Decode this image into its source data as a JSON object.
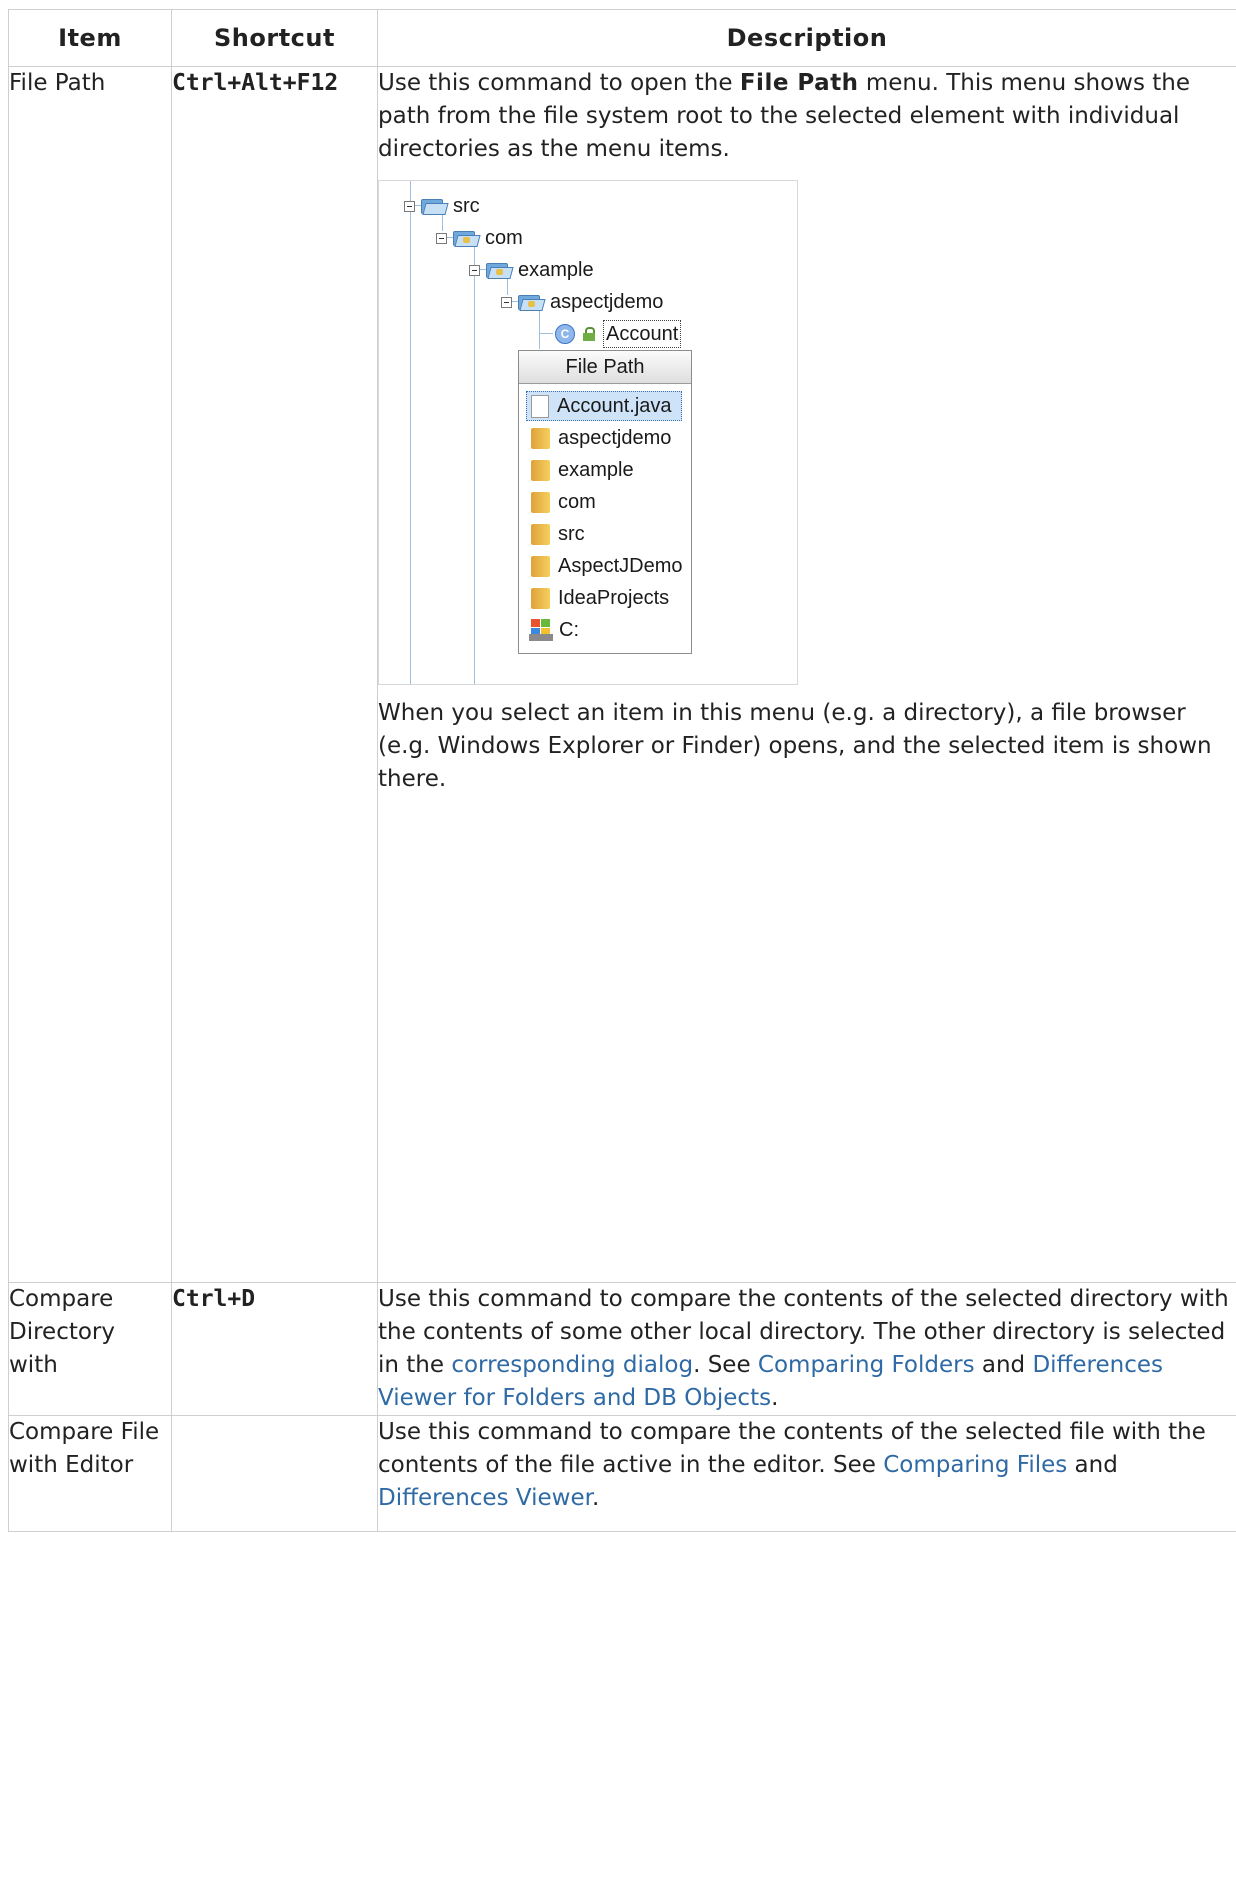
{
  "table": {
    "headers": [
      "Item",
      "Shortcut",
      "Description"
    ]
  },
  "rows": [
    {
      "item": "File Path",
      "shortcut": "Ctrl+Alt+F12",
      "desc_part1": "Use this command to open the ",
      "desc_bold": "File Path",
      "desc_part2": " menu. This menu shows the path from the file system root to the selected element with individual directories as the menu items.",
      "after_figure": "When you select an item in this menu (e.g. a directory), a file browser (e.g. Windows Explorer or Finder) opens, and the selected item is shown there."
    },
    {
      "item": "Compare Directory with",
      "shortcut": "Ctrl+D",
      "desc_part1": "Use this command to compare the contents of the selected directory with the contents of some other local directory. The other directory is selected in the ",
      "link1": "corresponding dialog",
      "desc_part2": ". See ",
      "link2": "Comparing Folders",
      "desc_part3": " and ",
      "link3": "Differences Viewer for Folders and DB Objects",
      "desc_part4": "."
    },
    {
      "item": "Compare File with Editor",
      "shortcut": "",
      "desc_part1": "Use this command to compare the contents of the selected file with the contents of the file active in the editor. See ",
      "link1": "Comparing Files",
      "desc_part2": " and ",
      "link2": "Differences Viewer",
      "desc_part3": "."
    }
  ],
  "figure": {
    "tree": [
      "src",
      "com",
      "example",
      "aspectjdemo",
      "Account"
    ],
    "class_icon_letter": "C",
    "popup_title": "File Path",
    "popup_items": [
      "Account.java",
      "aspectjdemo",
      "example",
      "com",
      "src",
      "AspectJDemo",
      "IdeaProjects",
      "C:"
    ]
  }
}
